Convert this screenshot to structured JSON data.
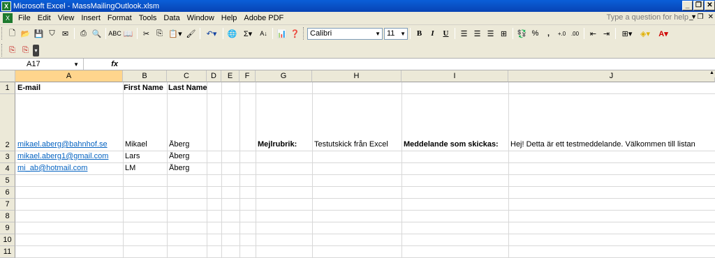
{
  "window": {
    "title": "Microsoft Excel - MassMailingOutlook.xlsm"
  },
  "menu": {
    "items": [
      "File",
      "Edit",
      "View",
      "Insert",
      "Format",
      "Tools",
      "Data",
      "Window",
      "Help",
      "Adobe PDF"
    ],
    "help_placeholder": "Type a question for help"
  },
  "toolbar": {
    "font_name": "Calibri",
    "font_size": "11",
    "bold": "B",
    "italic": "I",
    "underline": "U",
    "percent": "%",
    "comma": ","
  },
  "formula_bar": {
    "name_box": "A17",
    "fx": "fx",
    "content": ""
  },
  "columns": [
    "A",
    "B",
    "C",
    "D",
    "E",
    "F",
    "G",
    "H",
    "I",
    "J"
  ],
  "rows": [
    "1",
    "2",
    "3",
    "4",
    "5",
    "6",
    "7",
    "8",
    "9",
    "10",
    "11"
  ],
  "cells": {
    "A1": "E-mail",
    "B1": "First Name",
    "C1": "Last Name",
    "A2": "mikael.aberg@bahnhof.se",
    "B2": "Mikael",
    "C2": "Åberg",
    "G2": "Mejlrubrik:",
    "H2": "Testutskick från Excel",
    "I2": "Meddelande som skickas:",
    "J2": "Hej! Detta är ett testmeddelande. Välkommen till listan",
    "A3": "mikael.aberg1@gmail.com",
    "B3": "Lars",
    "C3": "Åberg",
    "A4": "mi_ab@hotmail.com",
    "B4": "LM",
    "C4": "Åberg"
  },
  "selected_cell": "A17"
}
